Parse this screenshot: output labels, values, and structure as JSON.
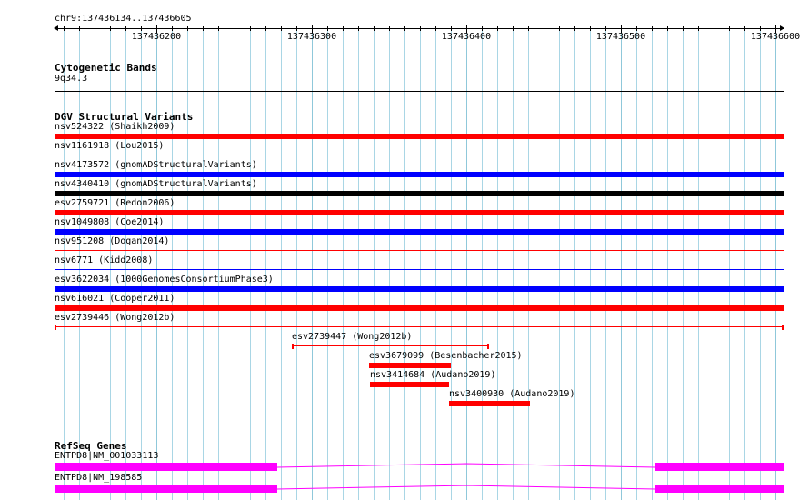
{
  "ruler": {
    "location": "chr9:137436134..137436605",
    "start": 137436134,
    "end": 137436605,
    "ticks": [
      "137436200",
      "137436300",
      "137436400",
      "137436500",
      "137436600"
    ]
  },
  "cytobands": {
    "title": "Cytogenetic Bands",
    "band": "9q34.3"
  },
  "dgv": {
    "title": "DGV Structural Variants",
    "colors": {
      "red": "#ff0000",
      "blue": "#0000ff",
      "black": "#000000"
    },
    "variants": [
      {
        "label": "nsv524322 (Shaikh2009)",
        "color": "red",
        "style": "thick",
        "start": 137436134,
        "end": 137436605
      },
      {
        "label": "nsv1161918 (Lou2015)",
        "color": "blue",
        "style": "thin",
        "start": 137436134,
        "end": 137436605
      },
      {
        "label": "nsv4173572 (gnomADStructuralVariants)",
        "color": "blue",
        "style": "thick",
        "start": 137436134,
        "end": 137436605
      },
      {
        "label": "nsv4340410 (gnomADStructuralVariants)",
        "color": "black",
        "style": "thick",
        "start": 137436134,
        "end": 137436605
      },
      {
        "label": "esv2759721 (Redon2006)",
        "color": "red",
        "style": "thick",
        "start": 137436134,
        "end": 137436605
      },
      {
        "label": "nsv1049808 (Coe2014)",
        "color": "blue",
        "style": "thick",
        "start": 137436134,
        "end": 137436605
      },
      {
        "label": "nsv951208 (Dogan2014)",
        "color": "red",
        "style": "thin",
        "start": 137436134,
        "end": 137436605
      },
      {
        "label": "nsv6771 (Kidd2008)",
        "color": "blue",
        "style": "thin",
        "start": 137436134,
        "end": 137436605
      },
      {
        "label": "esv3622034 (1000GenomesConsortiumPhase3)",
        "color": "blue",
        "style": "thick",
        "start": 137436134,
        "end": 137436605
      },
      {
        "label": "nsv616021 (Cooper2011)",
        "color": "red",
        "style": "thick",
        "start": 137436134,
        "end": 137436605
      },
      {
        "label": "esv2739446 (Wong2012b)",
        "color": "red",
        "style": "capped",
        "start": 137436134,
        "end": 137436605
      },
      {
        "label": "esv2739447 (Wong2012b)",
        "color": "red",
        "style": "capped",
        "start": 137436287,
        "end": 137436415
      },
      {
        "label": "esv3679099 (Besenbacher2015)",
        "color": "red",
        "style": "thick",
        "start": 137436337,
        "end": 137436390
      },
      {
        "label": "nsv3414684 (Audano2019)",
        "color": "red",
        "style": "thick",
        "start": 137436338,
        "end": 137436389
      },
      {
        "label": "nsv3400930 (Audano2019)",
        "color": "red",
        "style": "thick",
        "start": 137436389,
        "end": 137436441
      }
    ]
  },
  "refseq": {
    "title": "RefSeq Genes",
    "color": "#ff00ff",
    "genes": [
      {
        "label": "ENTPD8|NM_001033113",
        "exons": [
          [
            137436134,
            137436278
          ],
          [
            137436522,
            137436605
          ]
        ]
      },
      {
        "label": "ENTPD8|NM_198585",
        "exons": [
          [
            137436134,
            137436278
          ],
          [
            137436522,
            137436605
          ]
        ]
      }
    ]
  }
}
